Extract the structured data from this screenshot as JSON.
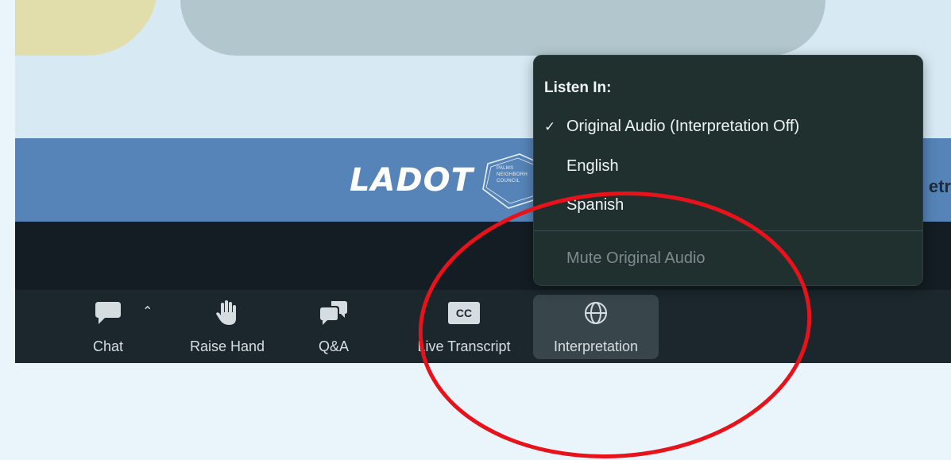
{
  "meeting_slide": {
    "logo_text": "LADOT",
    "council_lines": [
      "PALMS",
      "NEIGHBORH",
      "COUNCIL"
    ],
    "partial_text": "etr"
  },
  "toolbar": {
    "chat_label": "Chat",
    "raise_hand_label": "Raise Hand",
    "qa_label": "Q&A",
    "live_transcript_label": "Live Transcript",
    "live_transcript_icon_text": "CC",
    "interpretation_label": "Interpretation"
  },
  "interpretation_menu": {
    "title": "Listen In:",
    "items": [
      {
        "label": "Original Audio (Interpretation Off)",
        "checked": true
      },
      {
        "label": "English",
        "checked": false
      },
      {
        "label": "Spanish",
        "checked": false
      }
    ],
    "mute_label": "Mute Original Audio"
  },
  "icons": {
    "chat": "chat-bubble-icon",
    "chevron": "chevron-up-icon",
    "raise_hand": "raised-hand-icon",
    "qa": "qa-bubbles-icon",
    "cc": "closed-caption-icon",
    "globe": "globe-icon",
    "check": "checkmark-icon"
  },
  "colors": {
    "annotation_circle": "#e8121a",
    "toolbar_bg": "#1b272d",
    "menu_bg": "#20302f",
    "slide_band": "#5684b8"
  }
}
